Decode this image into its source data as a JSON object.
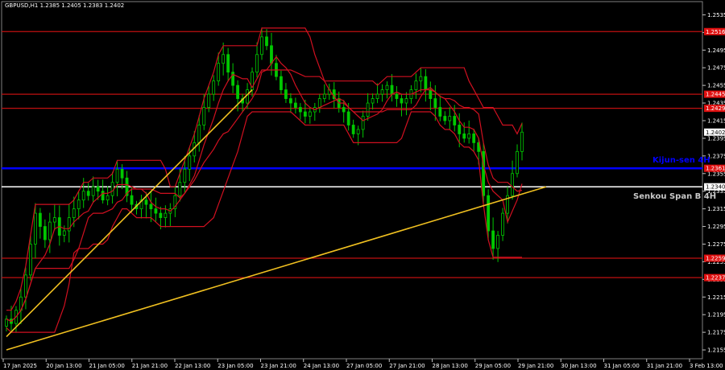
{
  "window": {
    "title": "GBPUSD,H1  1.2385 1.2405 1.2383 1.2402"
  },
  "colors": {
    "background": "#000000",
    "candle": "#00c800",
    "ichimoku": "#d01020",
    "kijun": "#0000ff",
    "senkou": "#ffffff",
    "trendline": "#f0c020",
    "level": "#c01010",
    "level_label_bg": "#e01010",
    "current_bg": "#ffffff"
  },
  "chart_data": {
    "type": "candlestick",
    "symbol": "GBPUSD",
    "timeframe": "H1",
    "ohlc_header": {
      "open": 1.2385,
      "high": 1.2405,
      "low": 1.2383,
      "close": 1.2402
    },
    "ylim": [
      1.2145,
      1.255
    ],
    "y_ticks": [
      "1.2535",
      "1.2515",
      "1.2495",
      "1.2475",
      "1.2455",
      "1.2435",
      "1.2415",
      "1.2395",
      "1.2375",
      "1.2355",
      "1.2335",
      "1.2315",
      "1.2295",
      "1.2275",
      "1.2255",
      "1.2235",
      "1.2215",
      "1.2195",
      "1.2175",
      "1.2155"
    ],
    "x_ticks": [
      "17 Jan 2025",
      "20 Jan 13:00",
      "21 Jan 05:00",
      "21 Jan 21:00",
      "22 Jan 13:00",
      "23 Jan 05:00",
      "23 Jan 21:00",
      "24 Jan 13:00",
      "27 Jan 05:00",
      "27 Jan 21:00",
      "28 Jan 13:00",
      "29 Jan 05:00",
      "29 Jan 21:00",
      "30 Jan 13:00",
      "31 Jan 05:00",
      "31 Jan 21:00",
      "3 Feb 13:00"
    ],
    "levels": [
      {
        "price": 1.2516,
        "label": "1.2516"
      },
      {
        "price": 1.2445,
        "label": "1.2445"
      },
      {
        "price": 1.2429,
        "label": "1.2429"
      },
      {
        "price": 1.2361,
        "label": "1.2361"
      },
      {
        "price": 1.2259,
        "label": "1.2259"
      },
      {
        "price": 1.2237,
        "label": "1.2237"
      }
    ],
    "kijun_sen": {
      "label": "Kijun-sen 4H",
      "price": 1.2361
    },
    "senkou_span_b": {
      "label": "Senkou Span B 4H",
      "price": 1.234
    },
    "current_price": {
      "price": 1.2402,
      "label": "1.2402"
    },
    "senkou_price_label": "1.2340",
    "close_series": [
      1.219,
      1.2185,
      1.22,
      1.2215,
      1.224,
      1.2275,
      1.231,
      1.2295,
      1.228,
      1.23,
      1.2305,
      1.2285,
      1.229,
      1.2305,
      1.2315,
      1.2325,
      1.2335,
      1.233,
      1.234,
      1.2335,
      1.2325,
      1.233,
      1.2345,
      1.236,
      1.235,
      1.233,
      1.232,
      1.2315,
      1.2325,
      1.232,
      1.2315,
      1.231,
      1.2305,
      1.231,
      1.2315,
      1.233,
      1.2345,
      1.236,
      1.2375,
      1.239,
      1.241,
      1.243,
      1.2445,
      1.246,
      1.248,
      1.249,
      1.247,
      1.2455,
      1.244,
      1.2435,
      1.245,
      1.247,
      1.249,
      1.251,
      1.25,
      1.248,
      1.2465,
      1.245,
      1.244,
      1.2435,
      1.243,
      1.2425,
      1.242,
      1.2425,
      1.243,
      1.244,
      1.2445,
      1.245,
      1.244,
      1.243,
      1.2425,
      1.241,
      1.24,
      1.2405,
      1.242,
      1.2435,
      1.244,
      1.2445,
      1.245,
      1.2455,
      1.2445,
      1.244,
      1.2435,
      1.244,
      1.245,
      1.246,
      1.2465,
      1.245,
      1.244,
      1.243,
      1.242,
      1.2415,
      1.242,
      1.241,
      1.24,
      1.2395,
      1.24,
      1.239,
      1.238,
      1.233,
      1.229,
      1.227,
      1.2285,
      1.231,
      1.233,
      1.2355,
      1.238,
      1.2402
    ],
    "trendlines": [
      {
        "from": [
          0,
          1.217
        ],
        "to": [
          51,
          1.245
        ]
      },
      {
        "from": [
          0,
          1.2155
        ],
        "to": [
          112,
          1.234
        ]
      }
    ]
  }
}
